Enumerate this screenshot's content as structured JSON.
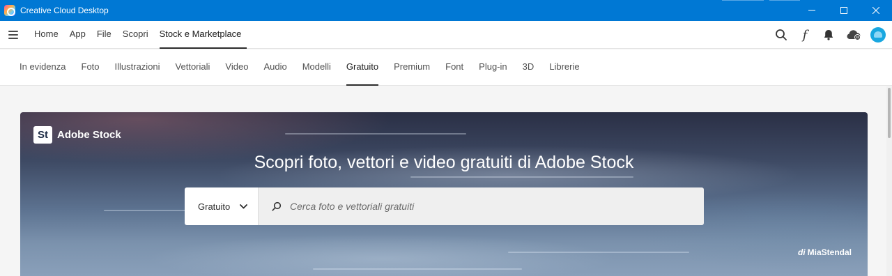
{
  "window": {
    "title": "Creative Cloud Desktop",
    "controls": {
      "minimize": "minimize-icon",
      "maximize": "maximize-icon",
      "close": "close-icon"
    }
  },
  "appnav": {
    "menu_icon": "hamburger-icon",
    "items": [
      {
        "label": "Home",
        "active": false
      },
      {
        "label": "App",
        "active": false
      },
      {
        "label": "File",
        "active": false
      },
      {
        "label": "Scopri",
        "active": false
      },
      {
        "label": "Stock e Marketplace",
        "active": true
      }
    ],
    "right_icons": [
      "search-icon",
      "fonts-icon",
      "bell-icon",
      "cloud-sync-icon",
      "avatar"
    ],
    "fonts_glyph": "f",
    "avatar_color": "#19a7e0"
  },
  "categories": {
    "tabs": [
      {
        "label": "In evidenza",
        "active": false
      },
      {
        "label": "Foto",
        "active": false
      },
      {
        "label": "Illustrazioni",
        "active": false
      },
      {
        "label": "Vettoriali",
        "active": false
      },
      {
        "label": "Video",
        "active": false
      },
      {
        "label": "Audio",
        "active": false
      },
      {
        "label": "Modelli",
        "active": false
      },
      {
        "label": "Gratuito",
        "active": true
      },
      {
        "label": "Premium",
        "active": false
      },
      {
        "label": "Font",
        "active": false
      },
      {
        "label": "Plug-in",
        "active": false
      },
      {
        "label": "3D",
        "active": false
      },
      {
        "label": "Librerie",
        "active": false
      }
    ]
  },
  "hero": {
    "brand_badge": "St",
    "brand_name": "Adobe Stock",
    "heading": "Scopri foto, vettori e video gratuiti di Adobe Stock",
    "search": {
      "filter_value": "Gratuito",
      "placeholder": "Cerca foto e vettoriali gratuiti"
    },
    "credit_prefix": "di",
    "credit_author": "MiaStendal"
  },
  "colors": {
    "titlebar": "#0078d4",
    "accent_underline": "#2c2c2c"
  }
}
